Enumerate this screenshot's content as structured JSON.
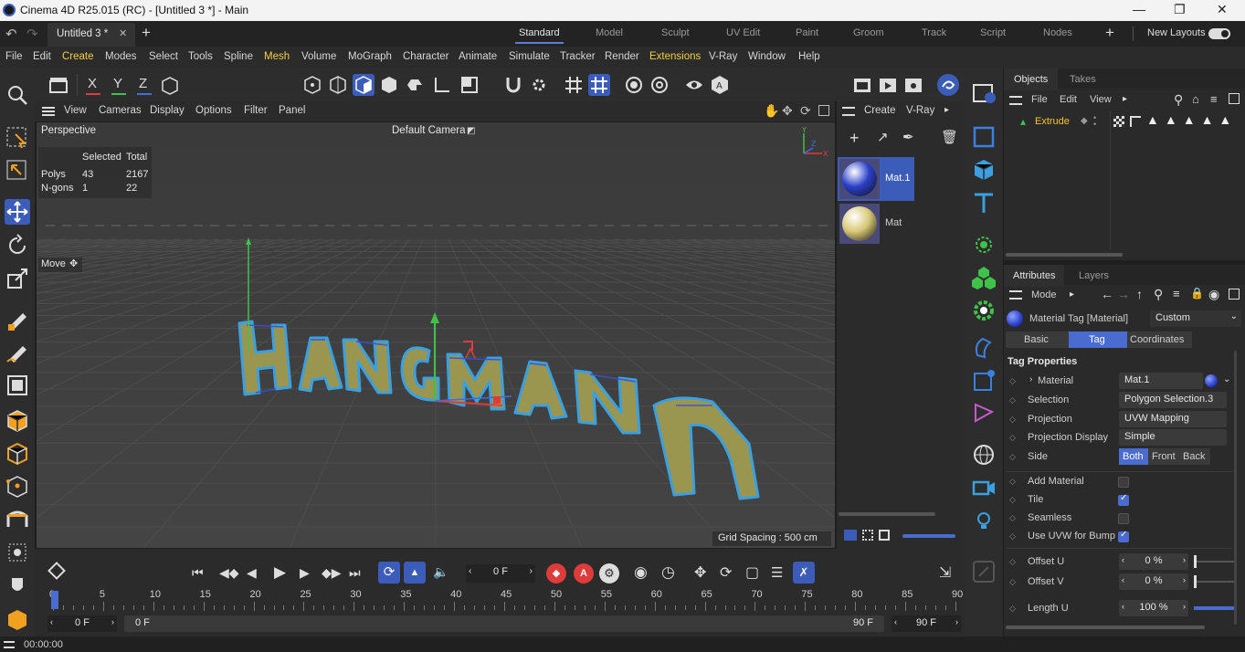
{
  "titlebar": {
    "title": "Cinema 4D R25.015 (RC) - [Untitled 3 *] - Main"
  },
  "tabs": {
    "document": "Untitled 3 *",
    "layouts": [
      "Standard",
      "Model",
      "Sculpt",
      "UV Edit",
      "Paint",
      "Groom",
      "Track",
      "Script",
      "Nodes"
    ],
    "active_layout": "Standard",
    "new_layouts": "New Layouts"
  },
  "menu": [
    "File",
    "Edit",
    "Create",
    "Modes",
    "Select",
    "Tools",
    "Spline",
    "Mesh",
    "Volume",
    "MoGraph",
    "Character",
    "Animate",
    "Simulate",
    "Tracker",
    "Render",
    "Extensions",
    "V-Ray",
    "Window",
    "Help"
  ],
  "axis_labels": {
    "x": "X",
    "y": "Y",
    "z": "Z"
  },
  "viewport": {
    "menu": [
      "View",
      "Cameras",
      "Display",
      "Options",
      "Filter",
      "Panel"
    ],
    "name": "Perspective",
    "camera": "Default Camera",
    "stats_header": {
      "selected": "Selected",
      "total": "Total"
    },
    "stats": [
      {
        "label": "Polys",
        "selected": "43",
        "total": "2167"
      },
      {
        "label": "N-gons",
        "selected": "1",
        "total": "22"
      }
    ],
    "tool": "Move",
    "grid_spacing": "Grid Spacing : 500 cm"
  },
  "materials": {
    "menu": [
      "Create",
      "V-Ray"
    ],
    "items": [
      {
        "name": "Mat.1",
        "color": "#2a3fc8",
        "selected": true
      },
      {
        "name": "Mat",
        "color": "#d8c978",
        "selected": false
      }
    ]
  },
  "objects": {
    "tabs": [
      "Objects",
      "Takes"
    ],
    "menu": [
      "File",
      "Edit",
      "View"
    ],
    "items": [
      {
        "name": "Extrude"
      }
    ]
  },
  "attributes": {
    "tabs": [
      "Attributes",
      "Layers"
    ],
    "mode": "Mode",
    "header": "Material Tag [Material]",
    "preset": "Custom",
    "subtabs": [
      "Basic",
      "Tag",
      "Coordinates"
    ],
    "active_subtab": "Tag",
    "section": "Tag Properties",
    "rows": [
      {
        "label": "Material",
        "value": "Mat.1"
      },
      {
        "label": "Selection",
        "value": "Polygon Selection.3"
      },
      {
        "label": "Projection",
        "value": "UVW Mapping"
      },
      {
        "label": "Projection Display",
        "value": "Simple"
      }
    ],
    "side": {
      "label": "Side",
      "options": [
        "Both",
        "Front",
        "Back"
      ],
      "active": "Both"
    },
    "checks": [
      {
        "label": "Add Material",
        "checked": false
      },
      {
        "label": "Tile",
        "checked": true
      },
      {
        "label": "Seamless",
        "checked": false
      },
      {
        "label": "Use UVW for Bump",
        "checked": true
      }
    ],
    "numbers": [
      {
        "label": "Offset U",
        "value": "0 %",
        "fraction": 0
      },
      {
        "label": "Offset V",
        "value": "0 %",
        "fraction": 0
      },
      {
        "label": "Length U",
        "value": "100 %",
        "fraction": 1
      }
    ]
  },
  "timeline": {
    "current_frame": "0 F",
    "ticks": [
      "0",
      "5",
      "10",
      "15",
      "20",
      "25",
      "30",
      "35",
      "40",
      "45",
      "50",
      "55",
      "60",
      "65",
      "70",
      "75",
      "80",
      "85",
      "90"
    ],
    "start": "0 F",
    "range_start": "0 F",
    "range_end": "90 F",
    "end": "90 F"
  },
  "status": {
    "time": "00:00:00"
  },
  "colors": {
    "accent": "#4a6bd0",
    "highlight": "#f2d040",
    "extrude_label": "#f2c530"
  }
}
